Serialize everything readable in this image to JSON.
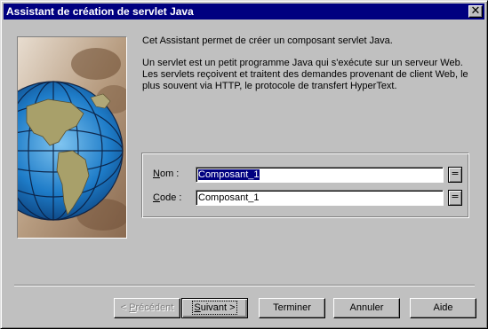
{
  "window": {
    "title": "Assistant de création de servlet Java",
    "close_glyph": "✕"
  },
  "intro": {
    "line1": "Cet Assistant permet de créer un composant servlet Java.",
    "line2": "Un servlet est un petit programme Java qui s'exécute sur un serveur Web. Les servlets reçoivent et traitent des demandes provenant de client Web, le plus souvent via HTTP, le protocole de transfert HyperText."
  },
  "fields": {
    "nom": {
      "label_accel": "N",
      "label_rest": "om :",
      "value": "Composant_1",
      "button": "="
    },
    "code": {
      "label_accel": "C",
      "label_rest": "ode :",
      "value": "Composant_1",
      "button": "="
    }
  },
  "buttons": {
    "previous": {
      "prefix": "< ",
      "accel": "P",
      "rest": "récédent"
    },
    "next": {
      "accel": "S",
      "rest": "uivant >"
    },
    "finish": "Terminer",
    "cancel": "Annuler",
    "help": "Aide"
  },
  "colors": {
    "titlebar": "#000080",
    "face": "#c0c0c0",
    "selection": "#000080"
  },
  "icons": {
    "illustration": "globe-illustration",
    "close": "close-icon"
  }
}
